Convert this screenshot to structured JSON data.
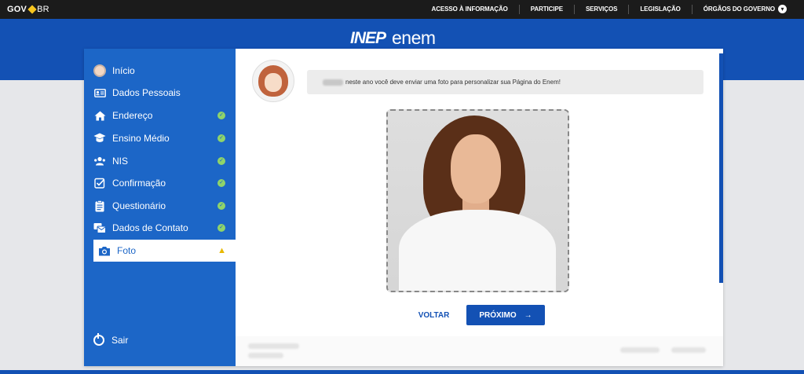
{
  "govbar": {
    "logo_gov": "GOV",
    "logo_br": "BR",
    "links": [
      "ACESSO À INFORMAÇÃO",
      "PARTICIPE",
      "SERVIÇOS",
      "LEGISLAÇÃO",
      "ÓRGÃOS DO GOVERNO"
    ],
    "dropdown_icon": "chevron-down-icon"
  },
  "header": {
    "brand_inep": "INEP",
    "brand_enem": "enem"
  },
  "sidebar": {
    "items": [
      {
        "label": "Início",
        "icon": "avatar-icon",
        "status": ""
      },
      {
        "label": "Dados Pessoais",
        "icon": "id-card-icon",
        "status": ""
      },
      {
        "label": "Endereço",
        "icon": "home-icon",
        "status": "done"
      },
      {
        "label": "Ensino Médio",
        "icon": "graduation-cap-icon",
        "status": "done"
      },
      {
        "label": "NIS",
        "icon": "people-icon",
        "status": "done"
      },
      {
        "label": "Confirmação",
        "icon": "checkbox-icon",
        "status": "done"
      },
      {
        "label": "Questionário",
        "icon": "clipboard-icon",
        "status": "done"
      },
      {
        "label": "Dados de Contato",
        "icon": "contact-icon",
        "status": "done"
      },
      {
        "label": "Foto",
        "icon": "camera-icon",
        "status": "warning"
      }
    ],
    "logout_label": "Sair"
  },
  "main": {
    "message": "neste ano você deve enviar uma foto para personalizar sua Página do Enem!",
    "back_label": "VOLTAR",
    "next_label": "PRÓXIMO",
    "next_arrow": "→"
  },
  "colors": {
    "primary": "#1351b4",
    "sidebar": "#1c66c7",
    "check": "#8fd46a",
    "warning": "#e8b800"
  }
}
